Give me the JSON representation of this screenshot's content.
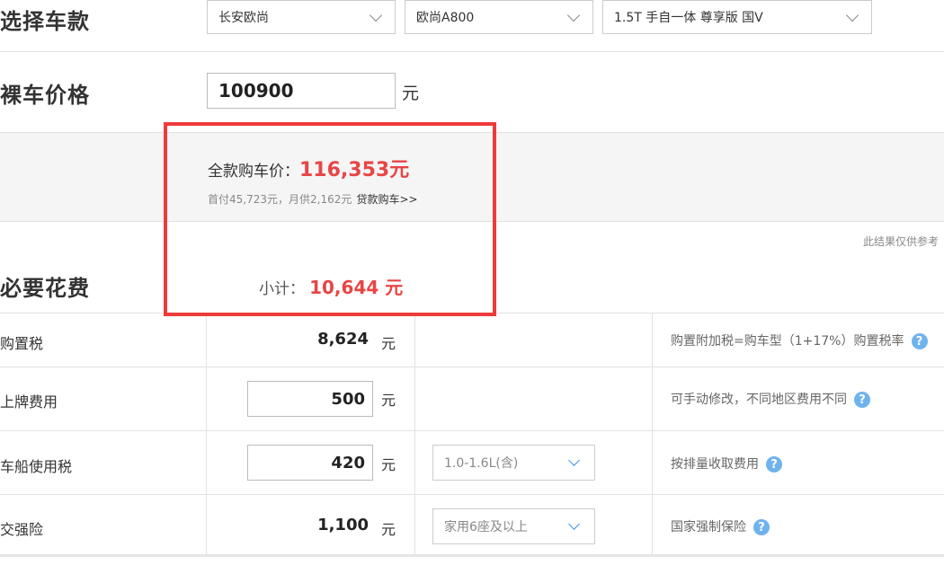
{
  "car_select": {
    "title": "选择车款",
    "brand": "长安欧尚",
    "model": "欧尚A800",
    "trim": "1.5T 手自一体 尊享版 国V"
  },
  "bare_price": {
    "title": "裸车价格",
    "value": "100900",
    "unit": "元"
  },
  "full_purchase": {
    "label": "全款购车价：",
    "price": "116,353元",
    "down_payment_info": "首付45,723元，月供2,162元",
    "loan_link": "贷款购车>>"
  },
  "disclaimer": "此结果仅供参考",
  "required_costs": {
    "title": "必要花费",
    "subtotal_label": "小计：",
    "subtotal_value": "10,644 元",
    "rows": [
      {
        "label": "购置税",
        "value": "8,624",
        "unit": "元",
        "note": "购置附加税=购车型（1+17%）购置税率"
      },
      {
        "label": "上牌费用",
        "value": "500",
        "unit": "元",
        "note": "可手动修改，不同地区费用不同"
      },
      {
        "label": "车船使用税",
        "value": "420",
        "unit": "元",
        "option": "1.0-1.6L(含)",
        "note": "按排量收取费用"
      },
      {
        "label": "交强险",
        "value": "1,100",
        "unit": "元",
        "option": "家用6座及以上",
        "note": "国家强制保险"
      }
    ]
  },
  "icons": {
    "help": "question-icon",
    "help_glyph": "?",
    "dropdown": "chevron-down-icon"
  },
  "colors": {
    "accent_red": "#e84545",
    "highlight_border": "#ef3a3a",
    "help_blue": "#6fb3ee"
  }
}
